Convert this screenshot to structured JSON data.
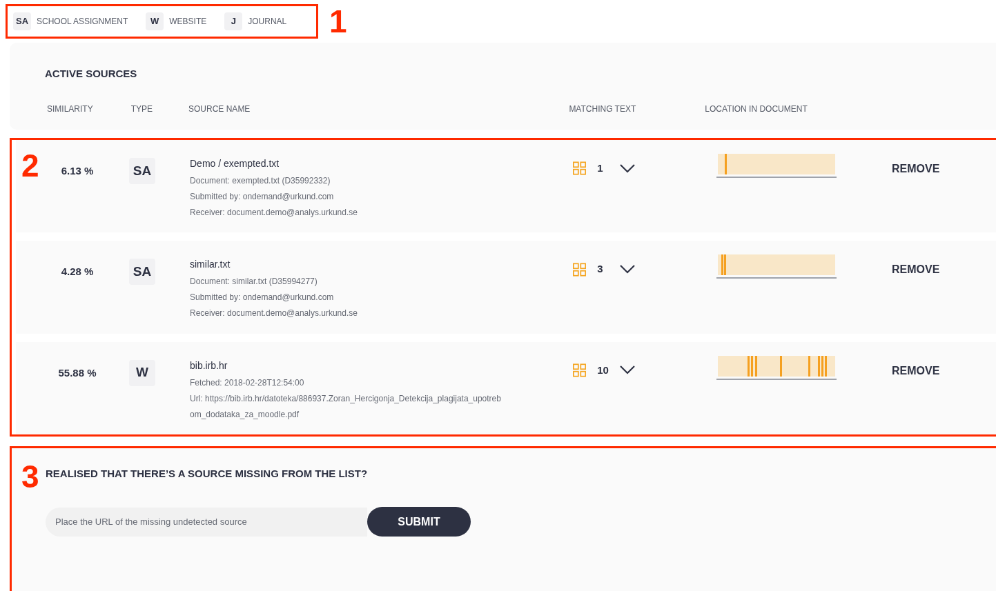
{
  "annotations": [
    {
      "label": "1"
    },
    {
      "label": "2"
    },
    {
      "label": "3"
    }
  ],
  "legend": [
    {
      "code": "SA",
      "label": "SCHOOL ASSIGNMENT"
    },
    {
      "code": "W",
      "label": "WEBSITE"
    },
    {
      "code": "J",
      "label": "JOURNAL"
    }
  ],
  "active_sources": {
    "title": "ACTIVE SOURCES",
    "columns": [
      "SIMILARITY",
      "TYPE",
      "SOURCE NAME",
      "MATCHING TEXT",
      "LOCATION IN DOCUMENT"
    ]
  },
  "sources": [
    {
      "similarity": "6.13 %",
      "type": "SA",
      "name": "Demo / exempted.txt",
      "details": [
        "Document: exempted.txt (D35992332)",
        "Submitted by: ondemand@urkund.com",
        "Receiver: document.demo@analys.urkund.se"
      ],
      "matches": "1",
      "markers": [
        {
          "level": 0.06
        }
      ],
      "action": "REMOVE"
    },
    {
      "similarity": "4.28 %",
      "type": "SA",
      "name": "similar.txt",
      "details": [
        "Document: similar.txt (D35994277)",
        "Submitted by: ondemand@urkund.com",
        "Receiver: document.demo@analys.urkund.se"
      ],
      "matches": "3",
      "markers": [
        {
          "level": 0.03
        },
        {
          "level": 0.05
        }
      ],
      "action": "REMOVE"
    },
    {
      "similarity": "55.88 %",
      "type": "W",
      "name": "bib.irb.hr",
      "details": [
        "Fetched: 2018-02-28T12:54:00",
        "Url: https://bib.irb.hr/datoteka/886937.Zoran_Hercigonja_Detekcija_plagijata_upotreb",
        "om_dodataka_za_moodle.pdf"
      ],
      "matches": "10",
      "markers": [
        {
          "level": 0.25
        },
        {
          "level": 0.28
        },
        {
          "level": 0.32
        },
        {
          "level": 0.53
        },
        {
          "level": 0.77
        },
        {
          "level": 0.85
        },
        {
          "level": 0.88
        },
        {
          "level": 0.91
        }
      ],
      "action": "REMOVE"
    }
  ],
  "missing_source": {
    "title": "REALISED THAT THERE’S A SOURCE MISSING FROM THE LIST?",
    "placeholder": "Place the URL of the missing undetected source",
    "button": "SUBMIT"
  }
}
